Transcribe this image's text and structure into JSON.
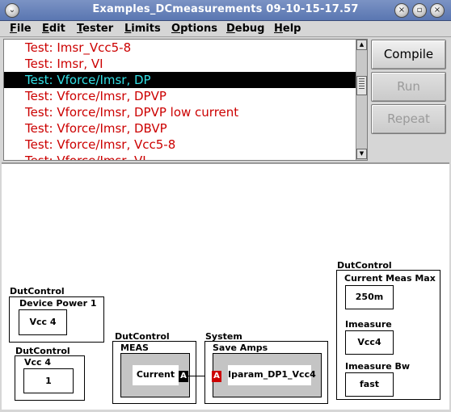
{
  "window": {
    "title": "Examples_DCmeasurements 09-10-15-17.57",
    "menu_glyph": "⌄",
    "min_glyph": "×",
    "max_glyph": "▫",
    "close_glyph": "×"
  },
  "menu": [
    {
      "u": "F",
      "rest": "ile"
    },
    {
      "u": "E",
      "rest": "dit"
    },
    {
      "u": "T",
      "rest": "ester"
    },
    {
      "u": "L",
      "rest": "imits"
    },
    {
      "u": "O",
      "rest": "ptions"
    },
    {
      "u": "D",
      "rest": "ebug"
    },
    {
      "u": "H",
      "rest": "elp"
    }
  ],
  "tests": [
    "Test: Imsr_Vcc5-8",
    "Test: Imsr, VI",
    "Test: Vforce/Imsr, DP",
    "Test: Vforce/Imsr, DPVP",
    "Test: Vforce/Imsr, DPVP low current",
    "Test: Vforce/Imsr, DBVP",
    "Test: Vforce/Imsr, Vcc5-8",
    "Test: Vforce/Imsr, VI"
  ],
  "buttons": {
    "compile": "Compile",
    "run": "Run",
    "repeat": "Repeat"
  },
  "diagram": {
    "power_block": {
      "group": "DutControl",
      "title": "Device Power 1",
      "value": "Vcc 4"
    },
    "vcc_block": {
      "group": "DutControl",
      "title": "Vcc 4",
      "value": "1"
    },
    "meas_block": {
      "group": "DutControl",
      "title": "MEAS",
      "value": "Current",
      "port": "A"
    },
    "save_block": {
      "group": "System",
      "title": "Save Amps",
      "value": "Iparam_DP1_Vcc4",
      "port": "A"
    },
    "current_block": {
      "group": "DutControl",
      "max_label": "Current Meas Max",
      "max_value": "250m",
      "imeasure_label": "Imeasure",
      "imeasure_value": "Vcc4",
      "bw_label": "Imeasure Bw",
      "bw_value": "fast"
    }
  },
  "colors": {
    "test_text": "#cc0000",
    "selected_text": "#33e0e6",
    "port_out": "#000000",
    "port_in": "#cc0000"
  }
}
